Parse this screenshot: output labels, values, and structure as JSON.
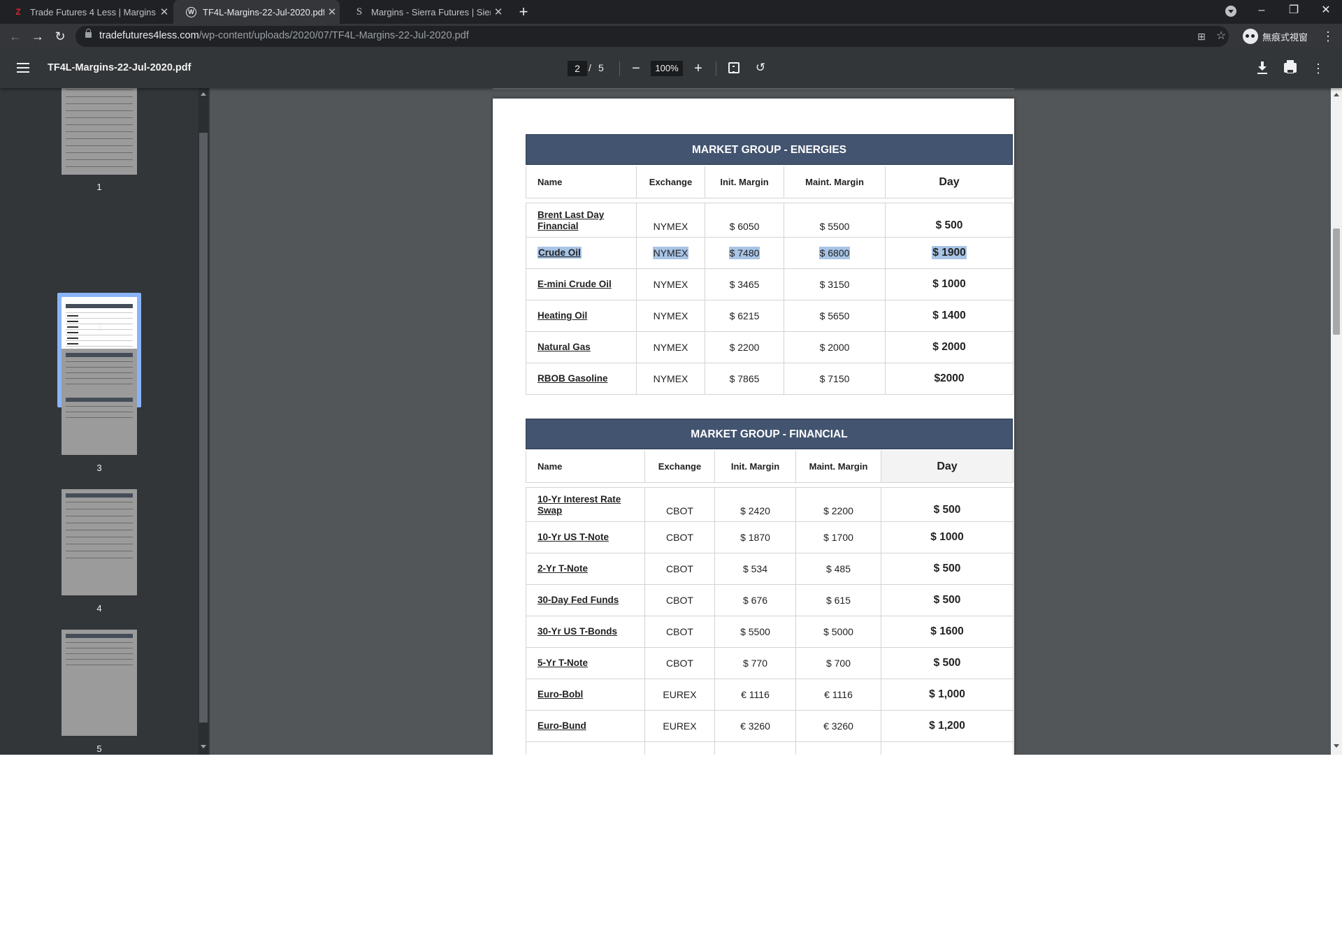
{
  "browser": {
    "tabs": [
      {
        "title": "Trade Futures 4 Less | Margins",
        "icon": "z-logo-icon",
        "active": false
      },
      {
        "title": "TF4L-Margins-22-Jul-2020.pdf",
        "icon": "wordpress-icon",
        "active": true
      },
      {
        "title": "Margins - Sierra Futures | Sierra",
        "icon": "sierra-s-icon",
        "active": false
      }
    ],
    "url_host": "tradefutures4less.com",
    "url_path": "/wp-content/uploads/2020/07/TF4L-Margins-22-Jul-2020.pdf",
    "profile_label": "無痕式視窗"
  },
  "pdf_viewer": {
    "filename": "TF4L-Margins-22-Jul-2020.pdf",
    "current_page": "2",
    "total_pages": "5",
    "zoom": "100%",
    "thumbnails": [
      "1",
      "2",
      "3",
      "4",
      "5"
    ],
    "selected_thumbnail": "2"
  },
  "document": {
    "energies": {
      "title": "MARKET GROUP - ENERGIES",
      "headers": [
        "Name",
        "Exchange",
        "Init. Margin",
        "Maint. Margin",
        "Day"
      ],
      "rows": [
        {
          "name": "Brent Last Day Financial",
          "exchange": "NYMEX",
          "init": "$ 6050",
          "maint": "$ 5500",
          "day": "$ 500"
        },
        {
          "name": "Crude Oil",
          "exchange": "NYMEX",
          "init": "$ 7480",
          "maint": "$ 6800",
          "day": "$ 1900"
        },
        {
          "name": "E-mini Crude Oil",
          "exchange": "NYMEX",
          "init": "$ 3465",
          "maint": "$ 3150",
          "day": "$ 1000"
        },
        {
          "name": "Heating Oil",
          "exchange": "NYMEX",
          "init": "$ 6215",
          "maint": "$ 5650",
          "day": "$ 1400"
        },
        {
          "name": "Natural Gas",
          "exchange": "NYMEX",
          "init": "$ 2200",
          "maint": "$ 2000",
          "day": "$ 2000"
        },
        {
          "name": "RBOB Gasoline",
          "exchange": "NYMEX",
          "init": "$ 7865",
          "maint": "$ 7150",
          "day": "$2000"
        }
      ]
    },
    "financial": {
      "title": "MARKET GROUP - FINANCIAL",
      "headers": [
        "Name",
        "Exchange",
        "Init. Margin",
        "Maint. Margin",
        "Day"
      ],
      "rows": [
        {
          "name": "10-Yr Interest Rate Swap",
          "exchange": "CBOT",
          "init": "$ 2420",
          "maint": "$ 2200",
          "day": "$ 500"
        },
        {
          "name": "10-Yr US T-Note",
          "exchange": "CBOT",
          "init": "$ 1870",
          "maint": "$ 1700",
          "day": "$ 1000"
        },
        {
          "name": "2-Yr T-Note",
          "exchange": "CBOT",
          "init": "$ 534",
          "maint": "$ 485",
          "day": "$ 500"
        },
        {
          "name": "30-Day Fed Funds",
          "exchange": "CBOT",
          "init": "$ 676",
          "maint": "$ 615",
          "day": "$ 500"
        },
        {
          "name": "30-Yr US T-Bonds",
          "exchange": "CBOT",
          "init": "$ 5500",
          "maint": "$ 5000",
          "day": "$ 1600"
        },
        {
          "name": "5-Yr T-Note",
          "exchange": "CBOT",
          "init": "$ 770",
          "maint": "$ 700",
          "day": "$ 500"
        },
        {
          "name": "Euro-Bobl",
          "exchange": "EUREX",
          "init": "€ 1116",
          "maint": "€ 1116",
          "day": "$ 1,000"
        },
        {
          "name": "Euro-Bund",
          "exchange": "EUREX",
          "init": "€ 3260",
          "maint": "€ 3260",
          "day": "$ 1,200"
        }
      ]
    }
  },
  "colors": {
    "table_header_bg": "#435470",
    "selection_highlight": "#a8c4e6",
    "viewer_background": "#525659",
    "toolbar_bg": "#323639"
  }
}
